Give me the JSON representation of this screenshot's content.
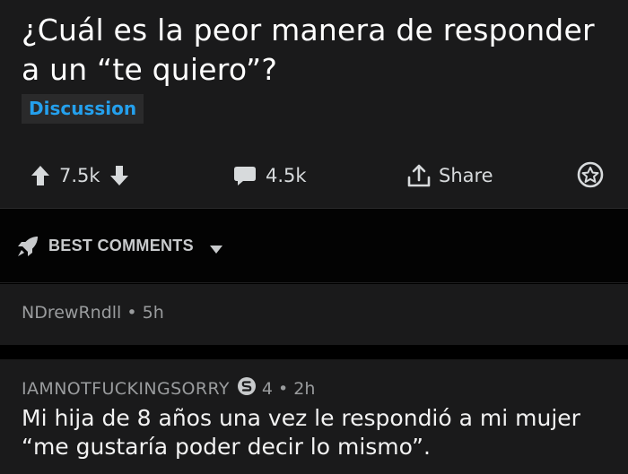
{
  "post": {
    "title": "¿Cuál es la peor manera de responder a un “te quiero”?",
    "flair": "Discussion",
    "upvotes": "7.5k",
    "comments": "4.5k",
    "share_label": "Share"
  },
  "sort": {
    "label": "BEST COMMENTS"
  },
  "comments": [
    {
      "author": "NDrewRndll",
      "age": "5h"
    },
    {
      "author": "IAMNOTFUCKINGSORRY",
      "score": "4",
      "age": "2h",
      "body": "Mi hija de 8 años una vez le respondió a mi mujer “me gustaría poder decir lo mismo”."
    }
  ],
  "icons": {
    "upvote": "arrow-up-icon",
    "downvote": "arrow-down-icon",
    "comments": "comment-bubble-icon",
    "share": "share-icon",
    "award": "award-icon",
    "sort": "rocket-icon",
    "caret": "chevron-down-icon",
    "badge": "flair-badge-icon"
  },
  "colors": {
    "background": "#1a1a1b",
    "flair_text": "#24a0ed",
    "title_text": "#ffffff",
    "meta_text": "#9a9c9e"
  }
}
